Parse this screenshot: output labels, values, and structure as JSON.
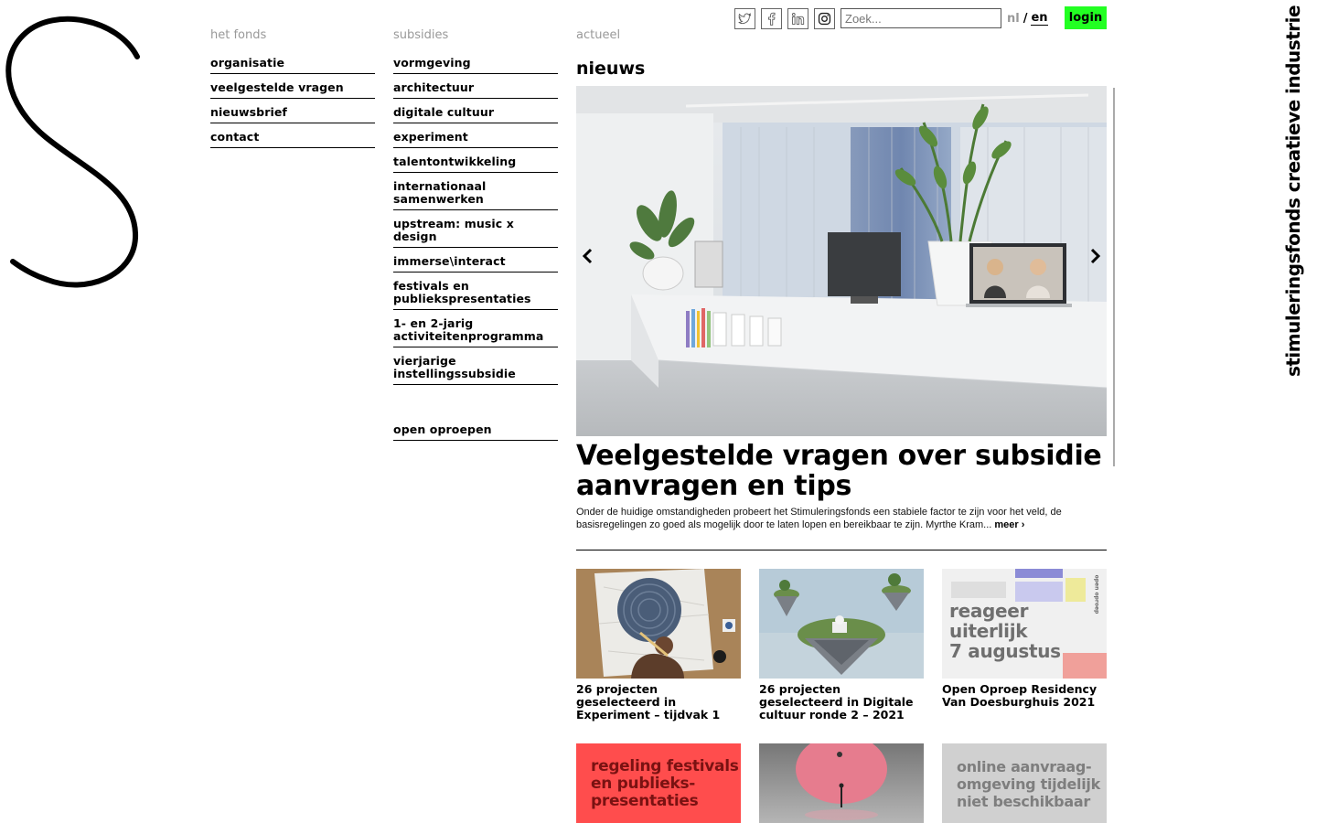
{
  "brand": {
    "vertical_text": "stimuleringsfonds creatieve industrie"
  },
  "toolbar": {
    "social": [
      "twitter-icon",
      "facebook-icon",
      "linkedin-icon",
      "instagram-icon"
    ],
    "search_placeholder": "Zoek...",
    "lang_nl": "nl",
    "lang_sep": "/",
    "lang_en": "en",
    "login_label": "login",
    "login_color": "#22ff22"
  },
  "nav": {
    "fonds": {
      "heading": "het fonds",
      "items": [
        "organisatie",
        "veelgestelde vragen",
        "nieuwsbrief",
        "contact"
      ]
    },
    "subsidies": {
      "heading": "subsidies",
      "items": [
        "vormgeving",
        "architectuur",
        "digitale cultuur",
        "experiment",
        "talentontwikkeling",
        "internationaal samenwerken",
        "upstream: music x design",
        "immerse\\interact",
        "festivals en publiekspresentaties",
        "1- en 2-jarig activiteitenprogramma",
        "vierjarige instellingssubsidie"
      ],
      "extra": "open oproepen"
    }
  },
  "actueel": {
    "heading": "actueel",
    "section_title": "nieuws",
    "headline": "Veelgestelde vragen over subsidie aanvragen en tips",
    "teaser": "Onder de huidige omstandigheden probeert het Stimuleringsfonds een stabiele factor te zijn voor het veld, de basisregelingen zo goed als mogelijk door te laten lopen en bereikbaar te zijn. Myrthe Kram...",
    "more_label": "meer ›"
  },
  "cards": [
    {
      "title": "26 projecten geselecteerd in Experiment – tijdvak 1"
    },
    {
      "title": "26 projecten geselecteerd in Digitale cultuur ronde 2 – 2021"
    },
    {
      "title": "Open Oproep Residency Van Doesburghuis 2021",
      "poster": [
        "reageer",
        "uiterlijk",
        "7 augustus"
      ],
      "poster_side": "open oproep"
    },
    {
      "poster": [
        "regeling festivals",
        "en publieks-",
        "presentaties"
      ],
      "poster_color": "#ff4d4d"
    },
    {},
    {
      "poster": [
        "online aanvraag-",
        "omgeving tijdelijk",
        "niet beschikbaar"
      ]
    }
  ]
}
